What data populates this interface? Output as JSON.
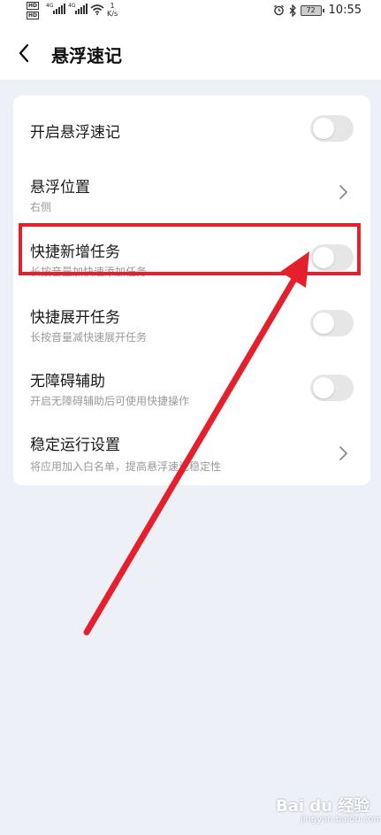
{
  "status_bar": {
    "speed_value": "1",
    "speed_unit": "K/s",
    "signal_label_1": "4G",
    "signal_label_2": "4G",
    "battery": "72",
    "time": "10:55"
  },
  "header": {
    "title": "悬浮速记"
  },
  "settings": {
    "items": [
      {
        "title": "开启悬浮速记",
        "subtitle": "",
        "control": "toggle",
        "enabled": false
      },
      {
        "title": "悬浮位置",
        "subtitle": "右侧",
        "control": "chevron"
      },
      {
        "title": "快捷新增任务",
        "subtitle": "长按音量加快速添加任务",
        "control": "toggle",
        "enabled": false
      },
      {
        "title": "快捷展开任务",
        "subtitle": "长按音量减快速展开任务",
        "control": "toggle",
        "enabled": false
      },
      {
        "title": "无障碍辅助",
        "subtitle": "开启无障碍辅助后可使用快捷操作",
        "control": "toggle",
        "enabled": false
      },
      {
        "title": "稳定运行设置",
        "subtitle": "将应用加入白名单，提高悬浮速记稳定性",
        "control": "chevron"
      }
    ]
  },
  "annotation": {
    "color": "#e5202c"
  },
  "watermark": {
    "text": "Bai du 经验",
    "sub": "jingyan.baidu.com"
  },
  "colors": {
    "background": "#edf0f6",
    "card": "#ffffff",
    "toggle_off": "#e6e6e6"
  }
}
